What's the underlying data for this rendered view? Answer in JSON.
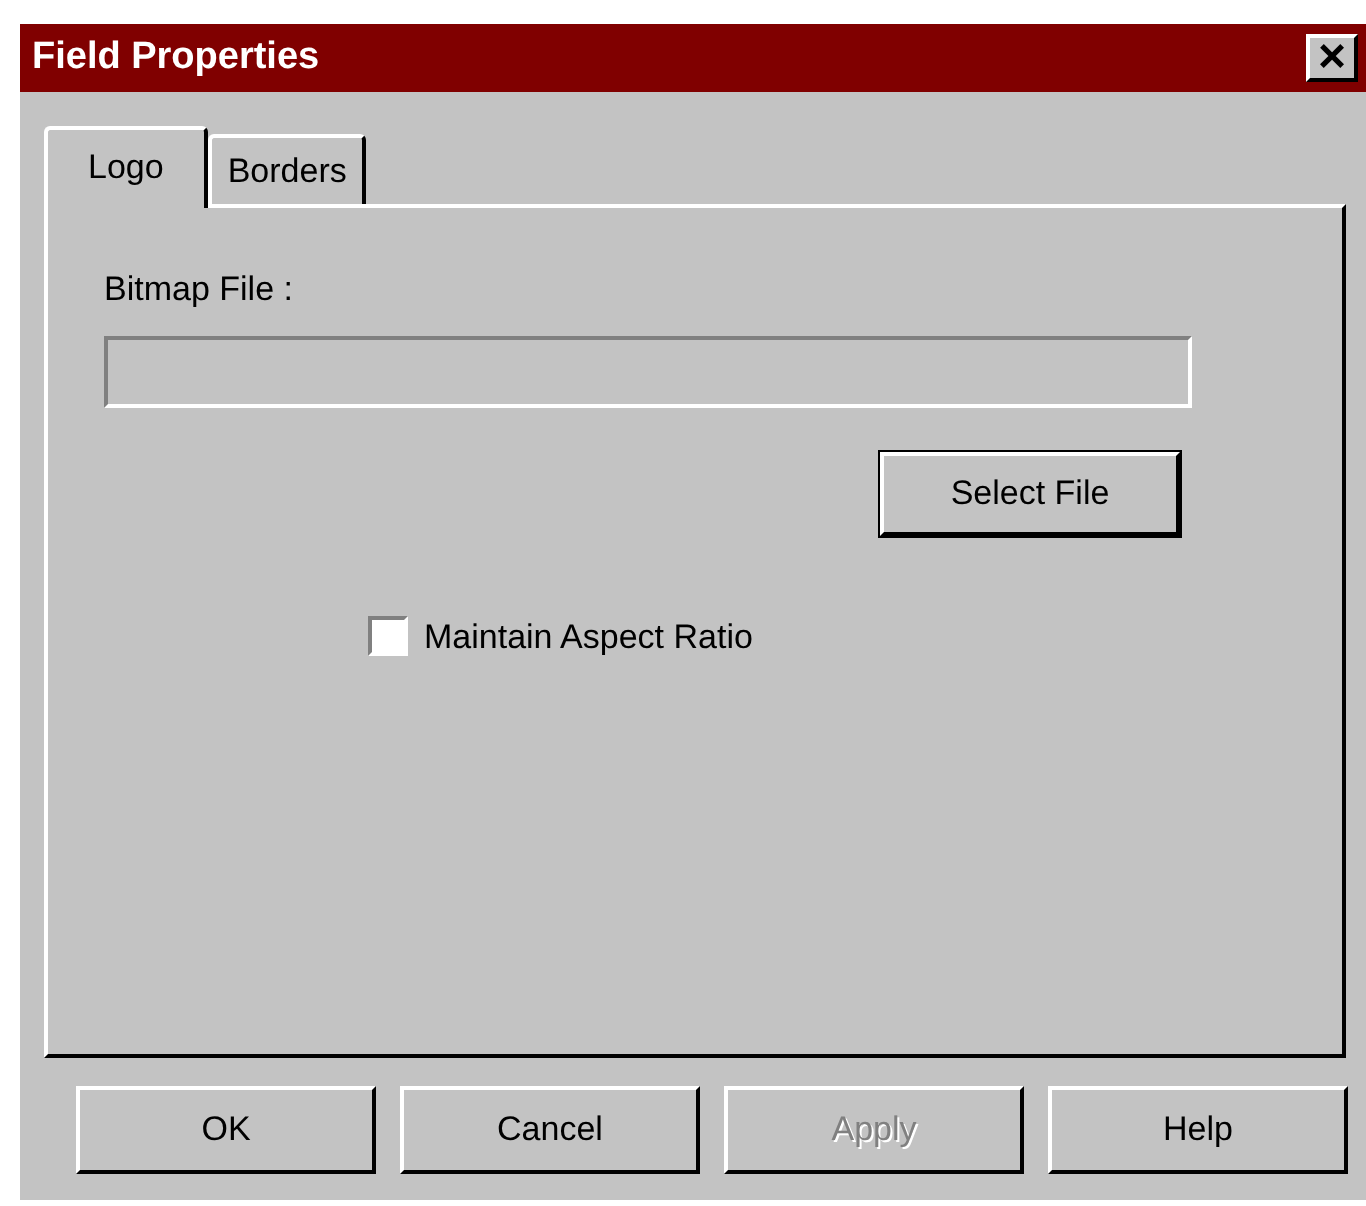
{
  "window": {
    "title": "Field Properties",
    "close": "×"
  },
  "tabs": [
    {
      "label": "Logo",
      "selected": true
    },
    {
      "label": "Borders",
      "selected": false
    }
  ],
  "bitmap_file": {
    "label": "Bitmap File :"
  },
  "select_file_button": {
    "label": "Select File"
  },
  "maintain_aspect_ratio": {
    "label": "Maintain Aspect Ratio",
    "checked": false
  },
  "buttons": [
    {
      "label": "OK",
      "disabled": false
    },
    {
      "label": "Cancel",
      "disabled": false
    },
    {
      "label": "Apply",
      "disabled": true
    },
    {
      "label": "Help",
      "disabled": false
    }
  ]
}
